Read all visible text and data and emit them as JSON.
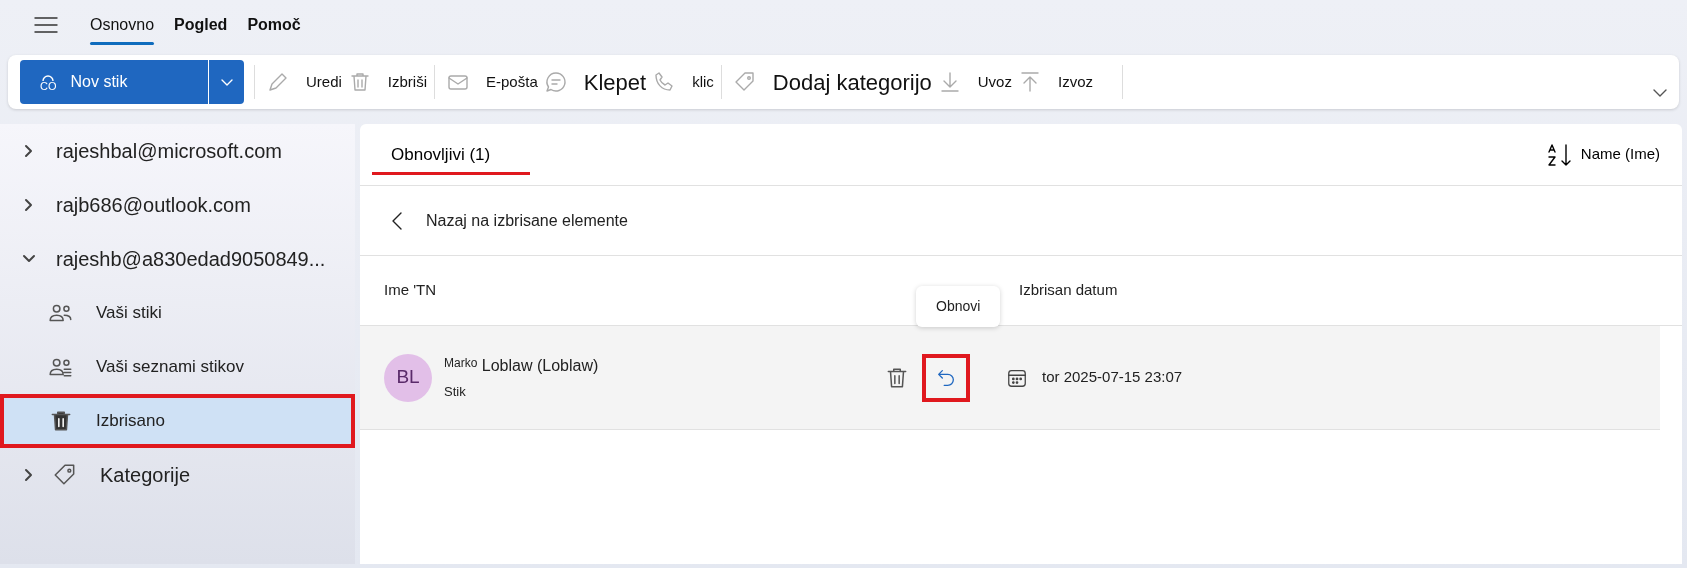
{
  "menu_tabs": [
    {
      "label": "Osnovno",
      "selected": true
    },
    {
      "label": "Pogled",
      "selected": false
    },
    {
      "label": "Pomoč",
      "selected": false
    }
  ],
  "toolbar": {
    "primary": {
      "label": "Nov stik",
      "icon_text": "CO"
    },
    "items": [
      {
        "kind": "edit",
        "label": "Uredi",
        "large": false
      },
      {
        "kind": "delete",
        "label": "Izbriši",
        "large": false
      },
      {
        "kind": "mail",
        "label": "E-pošta",
        "large": false
      },
      {
        "kind": "chat",
        "label": "Klepet",
        "large": true
      },
      {
        "kind": "call",
        "label": "klic",
        "large": false
      },
      {
        "kind": "tag",
        "label": "Dodaj kategorijo",
        "large": true
      },
      {
        "kind": "import",
        "label": "Uvoz",
        "large": false
      },
      {
        "kind": "export",
        "label": "Izvoz",
        "large": false
      }
    ]
  },
  "sidebar": {
    "items": [
      {
        "kind": "account",
        "label": "rajeshbal@microsoft.com",
        "expanded": false,
        "selected": false
      },
      {
        "kind": "account",
        "label": "rajb686@outlook.com",
        "expanded": false,
        "selected": false
      },
      {
        "kind": "account",
        "label": "rajeshb@a830edad9050849...",
        "expanded": true,
        "selected": false,
        "children": [
          {
            "kind": "contacts",
            "label": "Vaši stiki",
            "selected": false
          },
          {
            "kind": "lists",
            "label": "Vaši seznami stikov",
            "selected": false
          },
          {
            "kind": "deleted",
            "label": "Izbrisano",
            "selected": true
          }
        ]
      },
      {
        "kind": "categories",
        "label": "Kategorije",
        "expanded": false,
        "selected": false
      }
    ]
  },
  "main": {
    "tab": {
      "label": "Obnovljivi (1)",
      "selected": true
    },
    "sort": {
      "label": "Name (Ime)"
    },
    "back_link": "Nazaj na izbrisane elemente",
    "table": {
      "columns": [
        "Ime 'TN",
        "Izbrisan datum"
      ],
      "rows": [
        {
          "initials": "BL",
          "name_prefix": "Marko",
          "name": "Loblaw (Loblaw)",
          "type": "Stik",
          "deleted_date": "tor 2025-07-15 23:07",
          "tooltip": "Obnovi"
        }
      ]
    }
  }
}
